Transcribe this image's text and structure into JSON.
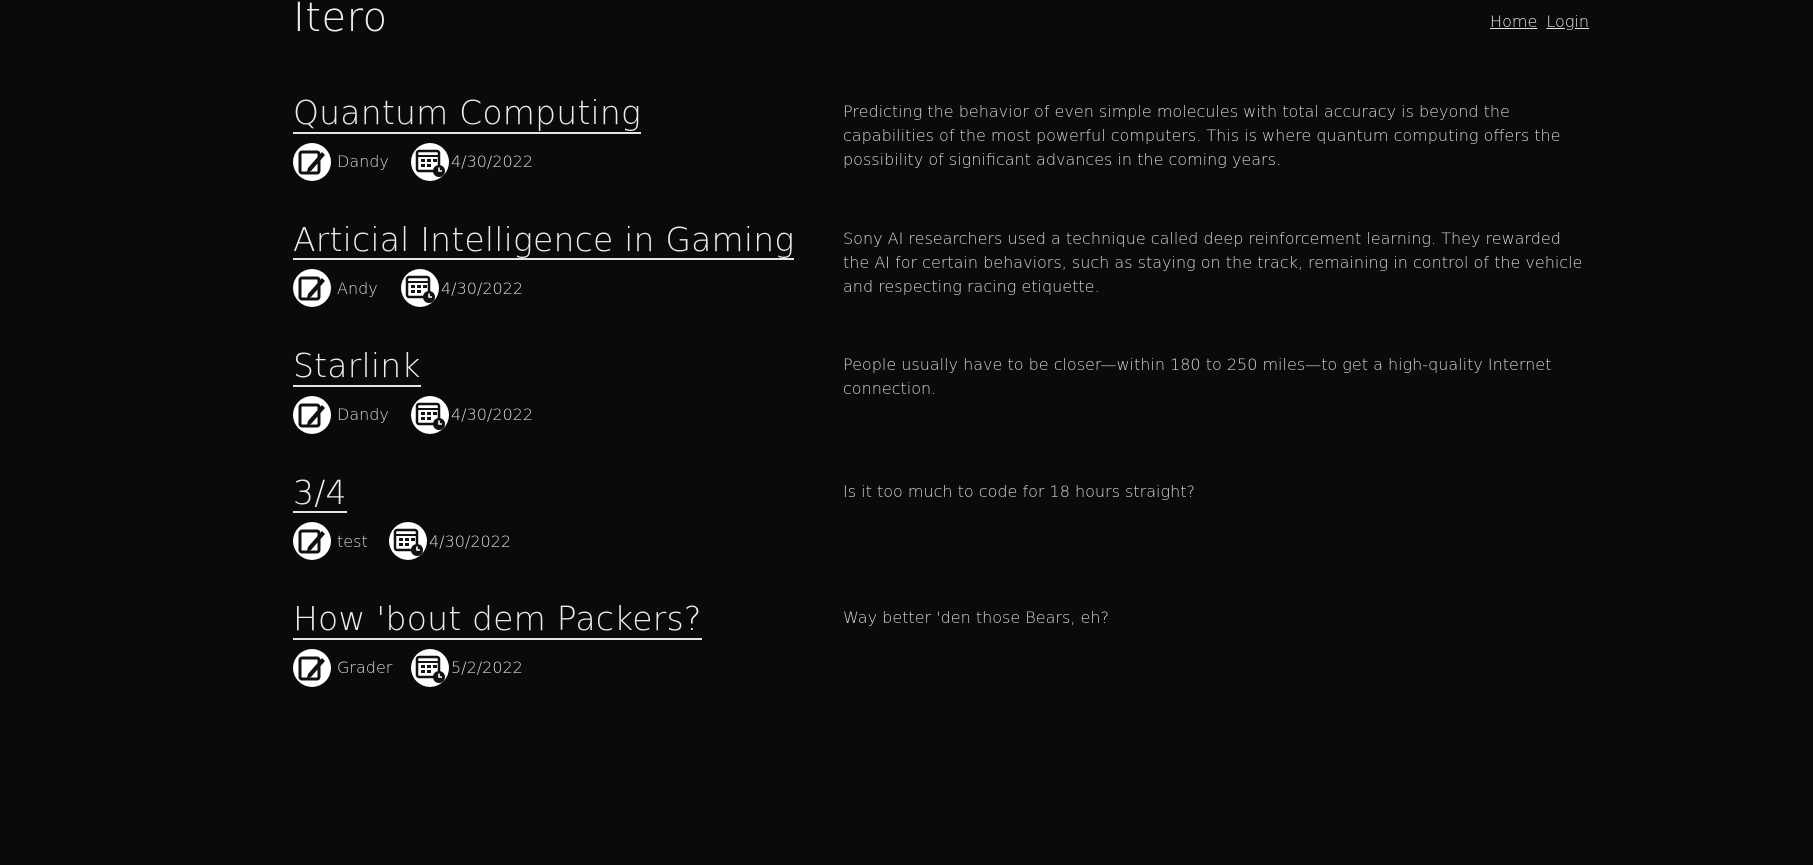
{
  "site": {
    "brand": "Itero"
  },
  "nav": {
    "home": "Home",
    "login": "Login"
  },
  "posts": [
    {
      "title": "Quantum Computing",
      "author": "Dandy",
      "date": "4/30/2022",
      "summary": "Predicting the behavior of even simple molecules with total accuracy is beyond the capabilities of the most powerful computers. This is where quantum computing offers the possibility of significant advances in the coming years."
    },
    {
      "title": "Articial Intelligence in Gaming",
      "author": "Andy",
      "date": "4/30/2022",
      "summary": "Sony AI researchers used a technique called deep reinforcement learning. They rewarded the AI for certain behaviors, such as staying on the track, remaining in control of the vehicle and respecting racing etiquette."
    },
    {
      "title": "Starlink",
      "author": "Dandy",
      "date": "4/30/2022",
      "summary": "People usually have to be closer—within 180 to 250 miles—to get a high-quality Internet connection."
    },
    {
      "title": "3/4",
      "author": "test",
      "date": "4/30/2022",
      "summary": "Is it too much to code for 18 hours straight?"
    },
    {
      "title": "How 'bout dem Packers?",
      "author": "Grader",
      "date": "5/2/2022",
      "summary": "Way better 'den those Bears, eh?"
    }
  ],
  "icons": {
    "author": "pencil-icon",
    "date": "calendar-clock-icon"
  },
  "colors": {
    "background": "#0b0a0b",
    "text": "#ece6e6"
  }
}
